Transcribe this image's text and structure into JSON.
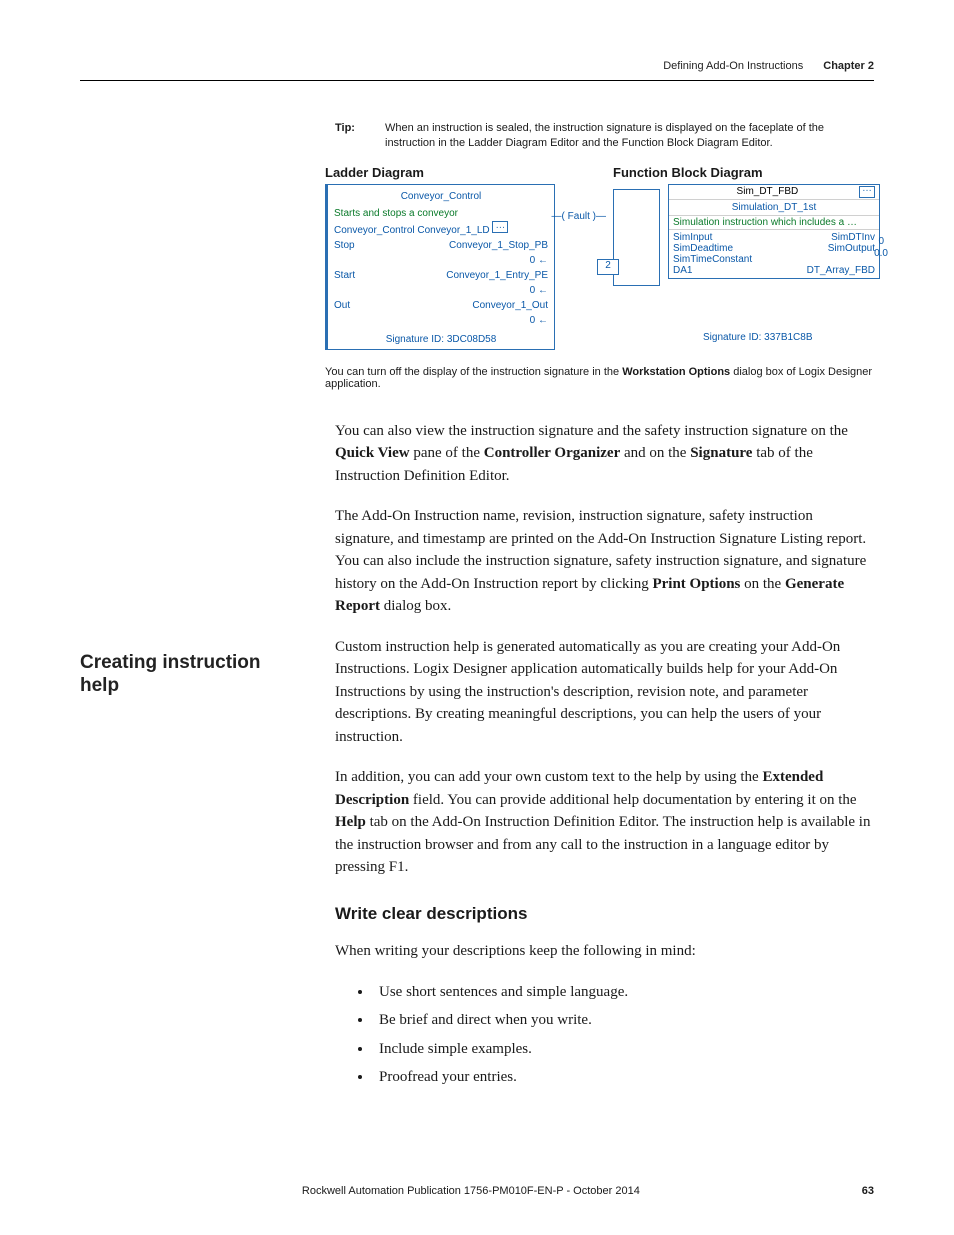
{
  "header": {
    "section": "Defining Add-On Instructions",
    "chapter": "Chapter 2"
  },
  "tip": {
    "label": "Tip:",
    "text": "When an instruction is sealed, the instruction signature is displayed on the faceplate of the instruction in the Ladder Diagram Editor and the Function Block Diagram Editor."
  },
  "ladder": {
    "title": "Ladder Diagram",
    "top": "Conveyor_Control",
    "desc": "Starts and stops a conveyor",
    "inst": "Conveyor_Control  Conveyor_1_LD",
    "fault": "—( Fault )—",
    "rows": [
      {
        "l": "Stop",
        "r": "Conveyor_1_Stop_PB",
        "v": "0 ←"
      },
      {
        "l": "Start",
        "r": "Conveyor_1_Entry_PE",
        "v": "0 ←"
      },
      {
        "l": "Out",
        "r": "Conveyor_1_Out",
        "v": "0 ←"
      }
    ],
    "sig": "Signature ID: 3DC08D58"
  },
  "fbd": {
    "title": "Function Block Diagram",
    "blockname": "Sim_DT_FBD",
    "instname": "Simulation_DT_1st",
    "desc": "Simulation instruction which includes a …",
    "smallval": "2",
    "leftports": [
      "SimInput",
      "SimDeadtime",
      "SimTimeConstant",
      "DA1"
    ],
    "rightports": [
      "SimDTInv",
      "SimOutput",
      "",
      "DT_Array_FBD"
    ],
    "side0": "0",
    "side00": "0.0",
    "sig": "Signature ID: 337B1C8B"
  },
  "caption": {
    "pre": "You can turn off the display of the instruction signature in the ",
    "bold": "Workstation Options",
    "post": " dialog box of Logix Designer application."
  },
  "para1": {
    "a": "You can also view the instruction signature and the safety instruction signature on the ",
    "b1": "Quick View",
    "b": " pane of the ",
    "b2": "Controller Organizer",
    "c": " and on the ",
    "b3": "Signature",
    "d": " tab of the Instruction Definition Editor."
  },
  "para2": {
    "a": "The Add-On Instruction name, revision, instruction signature, safety instruction signature, and timestamp are printed on the Add-On Instruction Signature Listing report. You can also include the instruction signature, safety instruction signature, and signature history on the Add-On Instruction report by clicking ",
    "b1": "Print Options",
    "b": " on the ",
    "b2": "Generate Report",
    "c": " dialog box."
  },
  "sidehead": "Creating instruction help",
  "para3": "Custom instruction help is generated automatically as you are creating your Add-On Instructions. Logix Designer application automatically builds help for your Add-On Instructions by using the instruction's description, revision note, and parameter descriptions. By creating meaningful descriptions, you can help the users of your instruction.",
  "para4": {
    "a": "In addition, you can add your own custom text to the help by using the ",
    "b1": "Extended Description",
    "b": " field. You can provide additional help documentation by entering it on the ",
    "b2": "Help",
    "c": " tab on the Add-On Instruction Definition Editor. The instruction help is available in the instruction browser and from any call to the instruction in a language editor by pressing F1."
  },
  "subhead": "Write clear descriptions",
  "para5": "When writing your descriptions keep the following in mind:",
  "bullets": [
    "Use short sentences and simple language.",
    "Be brief and direct when you write.",
    "Include simple examples.",
    "Proofread your entries."
  ],
  "footer": {
    "pub": "Rockwell Automation Publication 1756-PM010F-EN-P - October 2014",
    "page": "63"
  }
}
